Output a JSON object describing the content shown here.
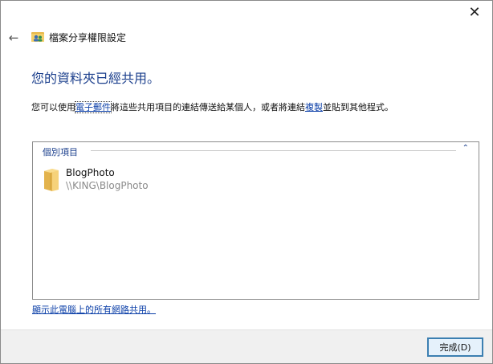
{
  "window": {
    "close_glyph": "✕",
    "back_glyph": "←",
    "title": "檔案分享權限設定"
  },
  "main": {
    "heading": "您的資料夾已經共用。",
    "desc_before": "您可以使用",
    "email_link": "電子郵件",
    "desc_middle": "將這些共用項目的連結傳送給某個人，或者將連結",
    "copy_link": "複製",
    "desc_after": "並貼到其他程式。"
  },
  "group": {
    "header": "個別項目",
    "collapse_glyph": "⌃",
    "items": [
      {
        "name": "BlogPhoto",
        "path": "\\\\KING\\BlogPhoto"
      }
    ]
  },
  "show_all_link": "顯示此電腦上的所有網路共用。",
  "footer": {
    "done_label": "完成(D)"
  },
  "colors": {
    "heading": "#1a3e8c",
    "link": "#0b3fa8",
    "footer_bg": "#f0f0f0",
    "button_border": "#3c7fb1"
  }
}
